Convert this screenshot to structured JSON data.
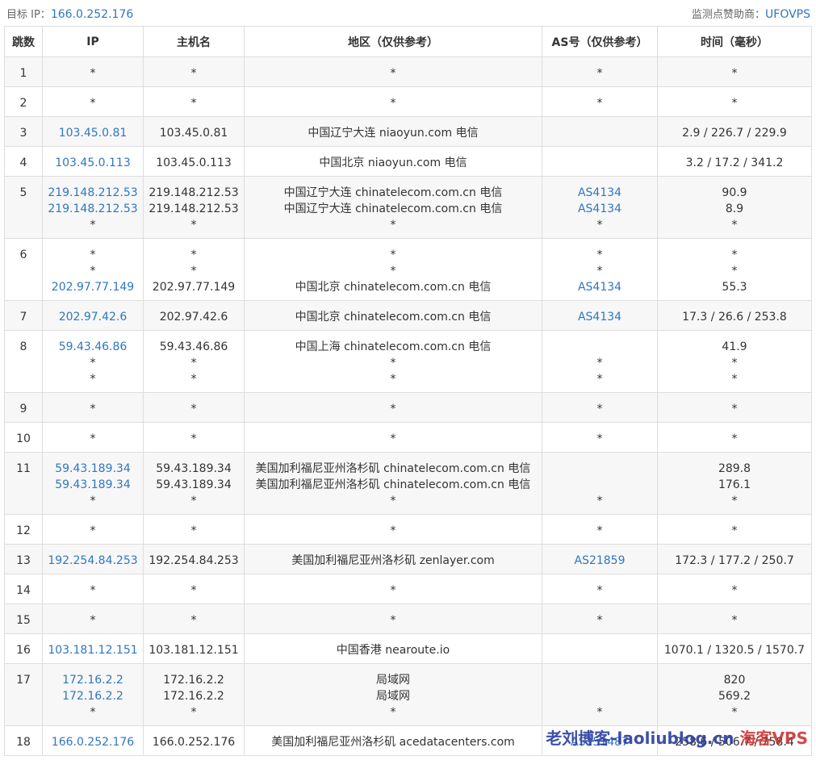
{
  "header": {
    "target_label": "目标 IP：",
    "target_ip": "166.0.252.176",
    "sponsor_label": "监测点赞助商：",
    "sponsor_name": "UFOVPS"
  },
  "columns": [
    "跳数",
    "IP",
    "主机名",
    "地区（仅供参考）",
    "AS号（仅供参考）",
    "时间（毫秒）"
  ],
  "rows": [
    {
      "hop": "1",
      "ip": [
        "*"
      ],
      "host": [
        "*"
      ],
      "region": [
        "*"
      ],
      "as": [
        "*"
      ],
      "time": [
        "*"
      ]
    },
    {
      "hop": "2",
      "ip": [
        "*"
      ],
      "host": [
        "*"
      ],
      "region": [
        "*"
      ],
      "as": [
        "*"
      ],
      "time": [
        "*"
      ]
    },
    {
      "hop": "3",
      "ip": [
        "103.45.0.81"
      ],
      "host": [
        "103.45.0.81"
      ],
      "region": [
        "中国辽宁大连 niaoyun.com 电信"
      ],
      "as": [],
      "time": [
        "2.9 / 226.7 / 229.9"
      ]
    },
    {
      "hop": "4",
      "ip": [
        "103.45.0.113"
      ],
      "host": [
        "103.45.0.113"
      ],
      "region": [
        "中国北京 niaoyun.com 电信"
      ],
      "as": [],
      "time": [
        "3.2 / 17.2 / 341.2"
      ]
    },
    {
      "hop": "5",
      "ip": [
        "219.148.212.53",
        "219.148.212.53",
        "*"
      ],
      "host": [
        "219.148.212.53",
        "219.148.212.53",
        "*"
      ],
      "region": [
        "中国辽宁大连 chinatelecom.com.cn 电信",
        "中国辽宁大连 chinatelecom.com.cn 电信",
        "*"
      ],
      "as": [
        "AS4134",
        "AS4134",
        "*"
      ],
      "time": [
        "90.9",
        "8.9",
        "*"
      ]
    },
    {
      "hop": "6",
      "ip": [
        "*",
        "*",
        "202.97.77.149"
      ],
      "host": [
        "*",
        "*",
        "202.97.77.149"
      ],
      "region": [
        "*",
        "*",
        "中国北京 chinatelecom.com.cn 电信"
      ],
      "as": [
        "*",
        "*",
        "AS4134"
      ],
      "time": [
        "*",
        "*",
        "55.3"
      ]
    },
    {
      "hop": "7",
      "ip": [
        "202.97.42.6"
      ],
      "host": [
        "202.97.42.6"
      ],
      "region": [
        "中国北京 chinatelecom.com.cn 电信"
      ],
      "as": [
        "AS4134"
      ],
      "time": [
        "17.3 / 26.6 / 253.8"
      ]
    },
    {
      "hop": "8",
      "ip": [
        "59.43.46.86",
        "*",
        "*"
      ],
      "host": [
        "59.43.46.86",
        "*",
        "*"
      ],
      "region": [
        "中国上海 chinatelecom.com.cn 电信",
        "*",
        "*"
      ],
      "as": [
        "",
        "*",
        "*"
      ],
      "time": [
        "41.9",
        "*",
        "*"
      ]
    },
    {
      "hop": "9",
      "ip": [
        "*"
      ],
      "host": [
        "*"
      ],
      "region": [
        "*"
      ],
      "as": [
        "*"
      ],
      "time": [
        "*"
      ]
    },
    {
      "hop": "10",
      "ip": [
        "*"
      ],
      "host": [
        "*"
      ],
      "region": [
        "*"
      ],
      "as": [
        "*"
      ],
      "time": [
        "*"
      ]
    },
    {
      "hop": "11",
      "ip": [
        "59.43.189.34",
        "59.43.189.34",
        "*"
      ],
      "host": [
        "59.43.189.34",
        "59.43.189.34",
        "*"
      ],
      "region": [
        "美国加利福尼亚州洛杉矶 chinatelecom.com.cn 电信",
        "美国加利福尼亚州洛杉矶 chinatelecom.com.cn 电信",
        "*"
      ],
      "as": [
        "",
        "",
        "*"
      ],
      "time": [
        "289.8",
        "176.1",
        "*"
      ]
    },
    {
      "hop": "12",
      "ip": [
        "*"
      ],
      "host": [
        "*"
      ],
      "region": [
        "*"
      ],
      "as": [
        "*"
      ],
      "time": [
        "*"
      ]
    },
    {
      "hop": "13",
      "ip": [
        "192.254.84.253"
      ],
      "host": [
        "192.254.84.253"
      ],
      "region": [
        "美国加利福尼亚州洛杉矶 zenlayer.com"
      ],
      "as": [
        "AS21859"
      ],
      "time": [
        "172.3 / 177.2 / 250.7"
      ]
    },
    {
      "hop": "14",
      "ip": [
        "*"
      ],
      "host": [
        "*"
      ],
      "region": [
        "*"
      ],
      "as": [
        "*"
      ],
      "time": [
        "*"
      ]
    },
    {
      "hop": "15",
      "ip": [
        "*"
      ],
      "host": [
        "*"
      ],
      "region": [
        "*"
      ],
      "as": [
        "*"
      ],
      "time": [
        "*"
      ]
    },
    {
      "hop": "16",
      "ip": [
        "103.181.12.151"
      ],
      "host": [
        "103.181.12.151"
      ],
      "region": [
        "中国香港 nearoute.io"
      ],
      "as": [],
      "time": [
        "1070.1 / 1320.5 / 1570.7"
      ]
    },
    {
      "hop": "17",
      "ip": [
        "172.16.2.2",
        "172.16.2.2",
        "*"
      ],
      "host": [
        "172.16.2.2",
        "172.16.2.2",
        "*"
      ],
      "region": [
        "局域网",
        "局域网",
        "*"
      ],
      "as": [
        "",
        "",
        "*"
      ],
      "time": [
        "820",
        "569.2",
        "*"
      ]
    },
    {
      "hop": "18",
      "ip": [
        "166.0.252.176"
      ],
      "host": [
        "166.0.252.176"
      ],
      "region": [
        "美国加利福尼亚州洛杉矶 acedatacenters.com"
      ],
      "as": [
        "AS151487"
      ],
      "time": [
        "258.6 / 506.7 / 758.4"
      ]
    }
  ],
  "watermark": {
    "part1": "老刘博客-laoliublog.cn",
    "part2": "海客VPS"
  },
  "colors": {
    "link": "#2f77c0",
    "border": "#dddddd",
    "stripe": "#f7f7f7"
  }
}
